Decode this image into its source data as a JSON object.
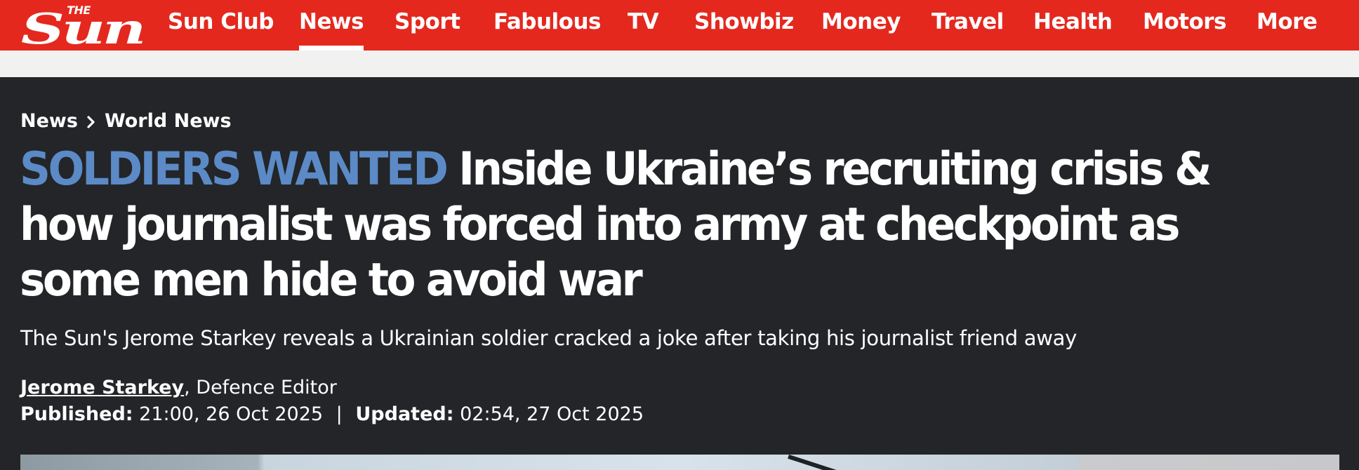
{
  "brand": {
    "logo_top": "THE",
    "logo_main": "Sun",
    "brand_color": "#e4281e"
  },
  "nav": {
    "items": [
      {
        "label": "Sun Club",
        "active": false
      },
      {
        "label": "News",
        "active": true
      },
      {
        "label": "Sport",
        "active": false
      },
      {
        "label": "Fabulous",
        "active": false
      },
      {
        "label": "TV",
        "active": false
      },
      {
        "label": "Showbiz",
        "active": false
      },
      {
        "label": "Money",
        "active": false
      },
      {
        "label": "Travel",
        "active": false
      },
      {
        "label": "Health",
        "active": false
      },
      {
        "label": "Motors",
        "active": false
      },
      {
        "label": "More",
        "active": false
      }
    ]
  },
  "breadcrumb": {
    "items": [
      "News",
      "World News"
    ],
    "separator_icon": "chevron-right-icon"
  },
  "article": {
    "kicker": "SOLDIERS WANTED",
    "headline": "Inside Ukraine’s recruiting crisis & how journalist was forced into army at checkpoint as some men hide to avoid war",
    "standfirst": "The Sun's Jerome Starkey reveals a Ukrainian soldier cracked a joke after taking his journalist friend away",
    "author": "Jerome Starkey",
    "author_role": ", Defence Editor",
    "published_label": "Published:",
    "published_value": "21:00, 26 Oct 2025",
    "date_separator": "|",
    "updated_label": "Updated:",
    "updated_value": "02:54, 27 Oct 2025",
    "kicker_color": "#5b8ac7",
    "background_color": "#232528"
  }
}
